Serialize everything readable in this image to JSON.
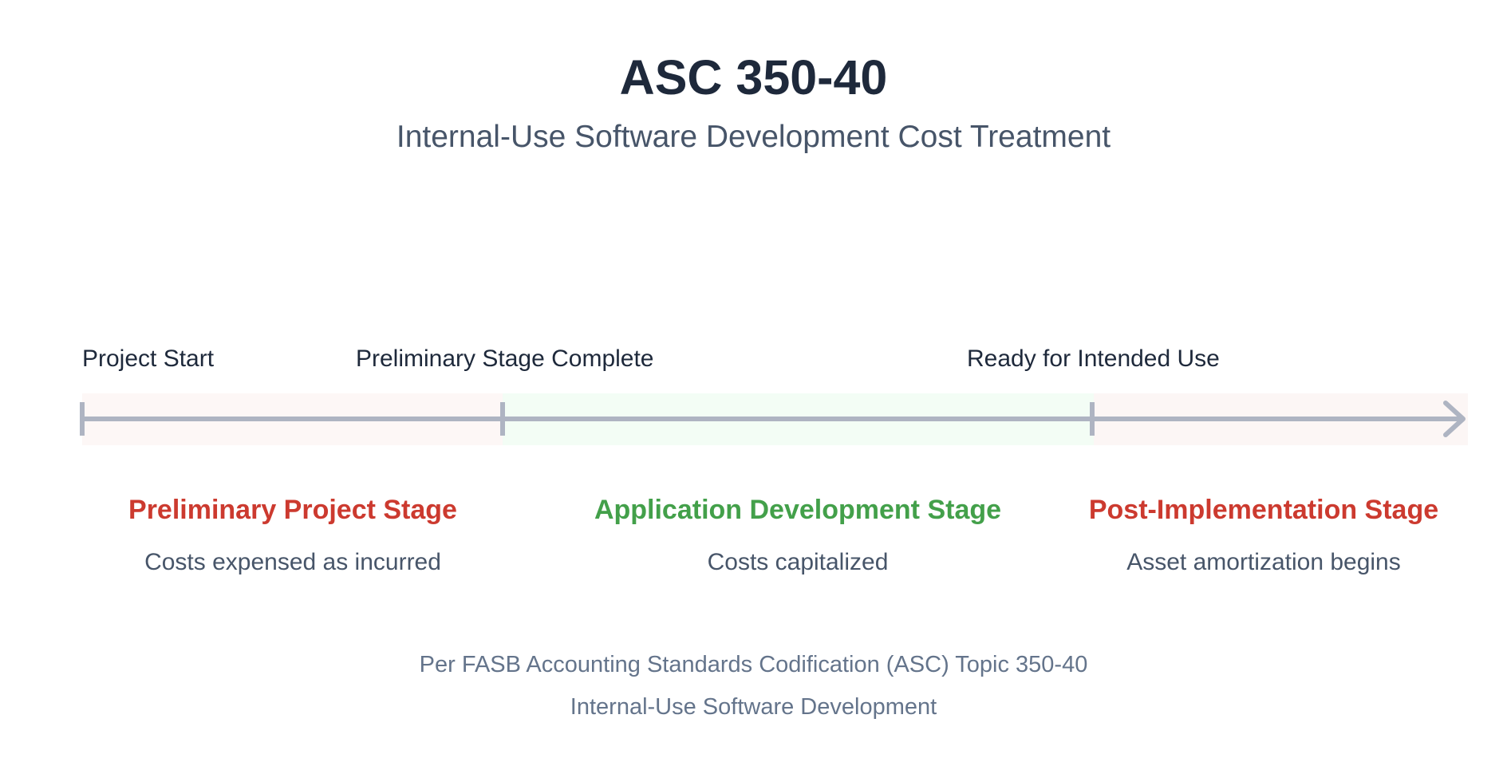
{
  "header": {
    "title": "ASC 350-40",
    "subtitle": "Internal-Use Software Development Cost Treatment"
  },
  "milestones": [
    {
      "label": "Project Start"
    },
    {
      "label": "Preliminary Stage Complete"
    },
    {
      "label": "Ready for Intended Use"
    }
  ],
  "stages": [
    {
      "name": "Preliminary Project Stage",
      "description": "Costs expensed as incurred",
      "color": "#cc3a2f"
    },
    {
      "name": "Application Development Stage",
      "description": "Costs capitalized",
      "color": "#43a04a"
    },
    {
      "name": "Post-Implementation Stage",
      "description": "Asset amortization begins",
      "color": "#cc3a2f"
    }
  ],
  "footer": {
    "line1": "Per FASB Accounting Standards Codification (ASC) Topic 350-40",
    "line2": "Internal-Use Software Development"
  },
  "colors": {
    "timeline": "#aeb4c2",
    "expense_band": "#fdf7f6",
    "capitalize_band": "#f3fdf5"
  }
}
